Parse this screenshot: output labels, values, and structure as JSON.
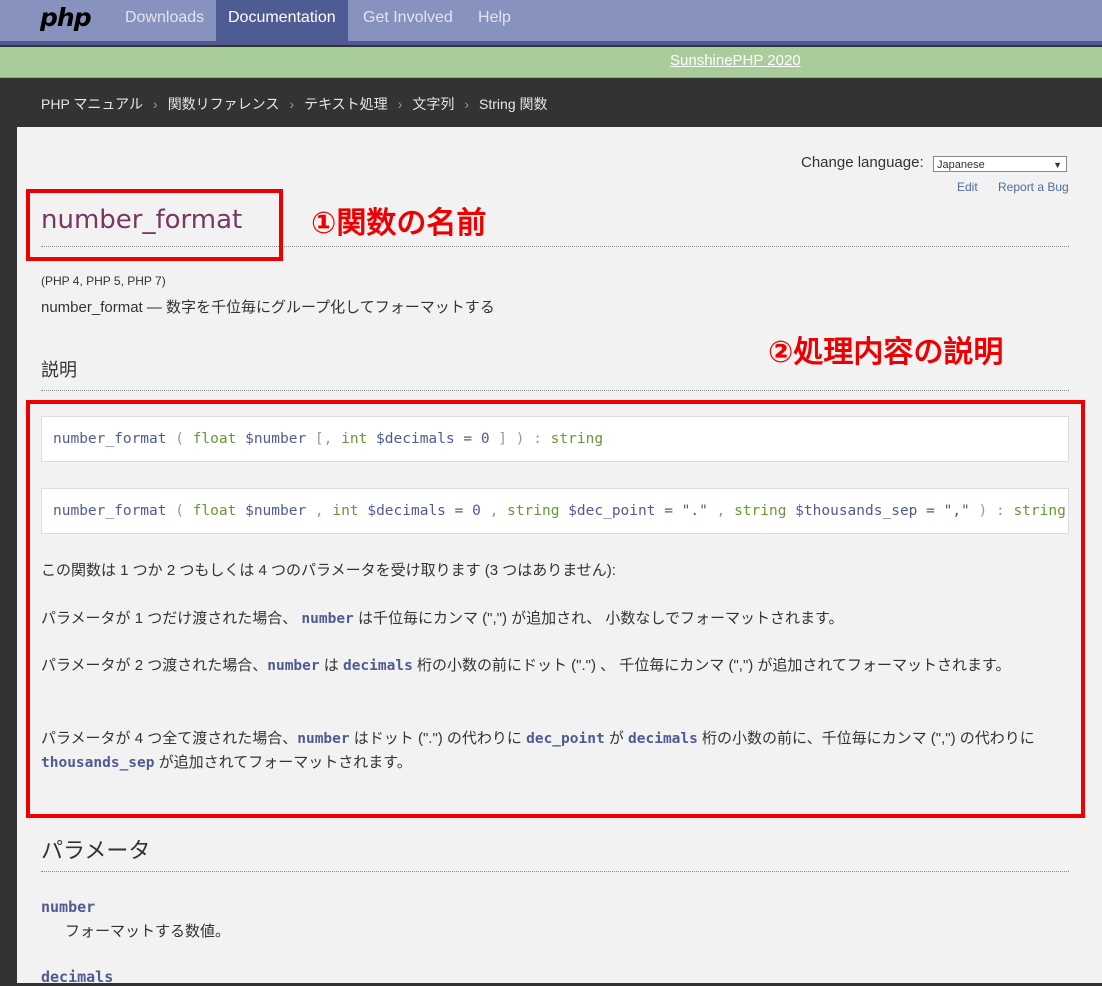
{
  "nav": {
    "logo": "php",
    "items": [
      "Downloads",
      "Documentation",
      "Get Involved",
      "Help"
    ],
    "active": "Documentation"
  },
  "banner": {
    "link": "SunshinePHP 2020"
  },
  "breadcrumbs": [
    "PHP マニュアル",
    "関数リファレンス",
    "テキスト処理",
    "文字列",
    "String 関数"
  ],
  "lang": {
    "label": "Change language:",
    "selected": "Japanese",
    "edit": "Edit",
    "report_bug": "Report a Bug"
  },
  "page": {
    "title": "number_format",
    "versions": "(PHP 4, PHP 5, PHP 7)",
    "refpurpose": "number_format — 数字を千位毎にグループ化してフォーマットする",
    "desc_heading": "説明",
    "params_heading": "パラメータ",
    "synopsis1": {
      "fn": "number_format",
      "open": " ( ",
      "t1": "float",
      "p1": " $number",
      "opt": " [, ",
      "t2": "int",
      "p2": " $decimals",
      "def2": " = 0",
      "close": " ] ) : ",
      "ret": "string"
    },
    "synopsis2": {
      "fn": "number_format",
      "open": " ( ",
      "t1": "float",
      "p1": " $number",
      "c1": " , ",
      "t2": "int",
      "p2": " $decimals",
      "def2": " = 0",
      "c2": " , ",
      "t3": "string",
      "p3": " $dec_point",
      "def3": " = \".\"",
      "c3": " , ",
      "t4": "string",
      "p4": " $thousands_sep",
      "def4": " = \",\"",
      "close": " ) : ",
      "ret": "string"
    },
    "para1": "この関数は 1 つか 2 つもしくは 4 つのパラメータを受け取ります (3 つはありません):",
    "para2": {
      "a": "パラメータが 1 つだけ渡された場合、 ",
      "b": "number",
      "c": " は千位毎にカンマ (\",\") が追加され、 小数なしでフォーマットされます。"
    },
    "para3": {
      "a": "パラメータが 2 つ渡された場合、",
      "b": "number",
      "c": " は ",
      "d": "decimals",
      "e": " 桁の小数の前にドット (\".\") 、 千位毎にカンマ (\",\") が追加されてフォーマットされます。"
    },
    "para4": {
      "a": "パラメータが 4 つ全て渡された場合、",
      "b": "number",
      "c": " はドット (\".\") の代わりに ",
      "d": "dec_point",
      "e": " が ",
      "f": "decimals",
      "g": " 桁の小数の前に、千位毎にカンマ (\",\") の代わりに ",
      "h": "thousands_sep",
      "i": " が追加されてフォーマットされます。"
    },
    "param_number": "number",
    "param_number_desc": "フォーマットする数値。",
    "param_decimals": "decimals"
  },
  "annotations": {
    "a1": "①関数の名前",
    "a2": "②処理内容の説明",
    "color": "#e00000"
  }
}
